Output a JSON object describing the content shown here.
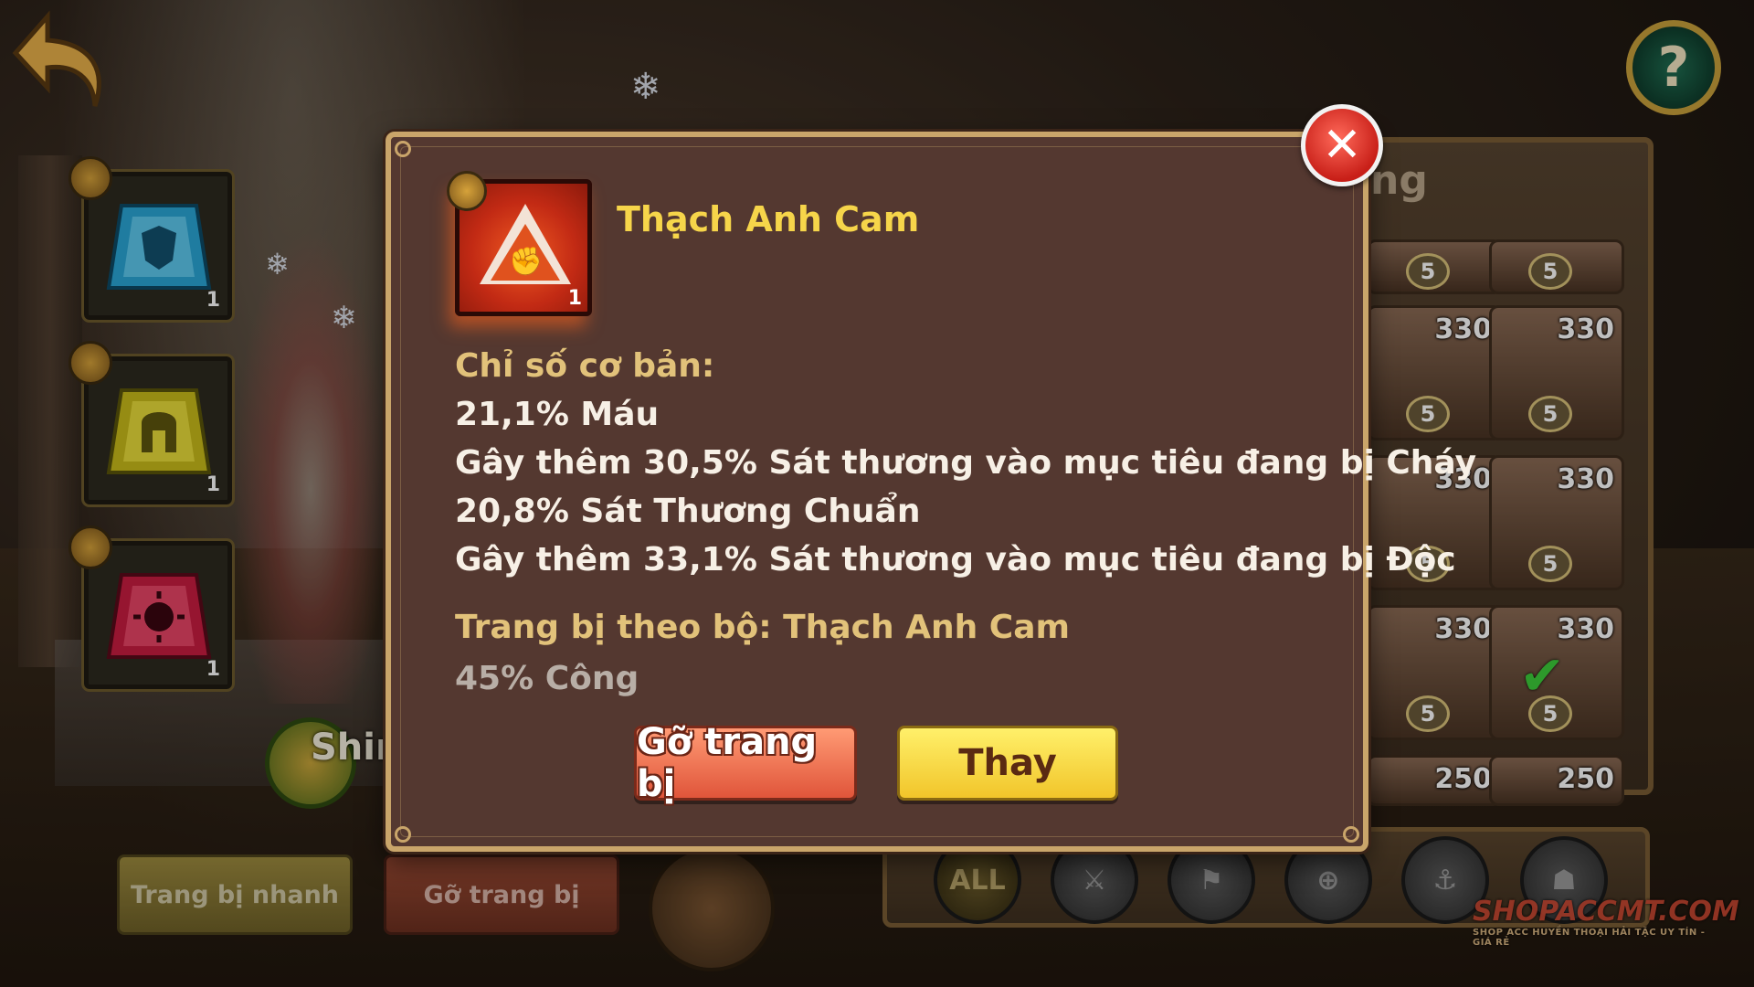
{
  "top": {
    "back_icon": "back-arrow-icon",
    "help_label": "?"
  },
  "left_slots": [
    {
      "gem": "blue-shield-gem",
      "count": "1",
      "color": "#2aa6d6"
    },
    {
      "gem": "yellow-helmet-gem",
      "count": "1",
      "color": "#d8cc22"
    },
    {
      "gem": "red-sun-gem",
      "count": "1",
      "color": "#d8284a"
    }
  ],
  "character_name_partial": "Shir",
  "bottom_buttons": {
    "quick_equip": "Trang bị nhanh",
    "unequip": "Gỡ trang bị"
  },
  "right_panel": {
    "title_partial": "ng",
    "heroes": [
      {
        "level": "",
        "stars": "5"
      },
      {
        "level": "",
        "stars": "5"
      },
      {
        "level": "330",
        "stars": "5"
      },
      {
        "level": "330",
        "stars": "5"
      },
      {
        "level": "330",
        "stars": "5"
      },
      {
        "level": "330",
        "stars": "5"
      },
      {
        "level": "330",
        "stars": "5"
      },
      {
        "level": "330",
        "stars": "5"
      },
      {
        "level": "250",
        "stars": ""
      },
      {
        "level": "250",
        "stars": ""
      }
    ],
    "filters": [
      "ALL",
      "sword-icon",
      "flag-icon",
      "crosshair-icon",
      "anchor-icon",
      "helmet-icon"
    ]
  },
  "dialog": {
    "item_name": "Thạch Anh Cam",
    "item_count": "1",
    "base_stats_title": "Chỉ số cơ bản:",
    "stats": [
      "21,1% Máu",
      "Gây thêm 30,5% Sát thương vào mục tiêu đang bị Cháy",
      "20,8% Sát Thương Chuẩn",
      "Gây thêm 33,1% Sát thương vào mục tiêu đang bị Độc"
    ],
    "set_title": "Trang bị theo bộ: Thạch Anh Cam",
    "set_bonus": "45% Công",
    "unequip_button": "Gỡ trang bị",
    "replace_button": "Thay",
    "close_icon": "close-x-icon"
  },
  "watermark": {
    "brand": "SHOPACCMT.COM",
    "tagline": "SHOP ACC HUYỀN THOẠI HẢI TẶC UY TÍN - GIÁ RẺ"
  },
  "colors": {
    "title_yellow": "#f6d54a",
    "dialog_bg": "#543830",
    "accent_gold": "#c9a56a"
  }
}
